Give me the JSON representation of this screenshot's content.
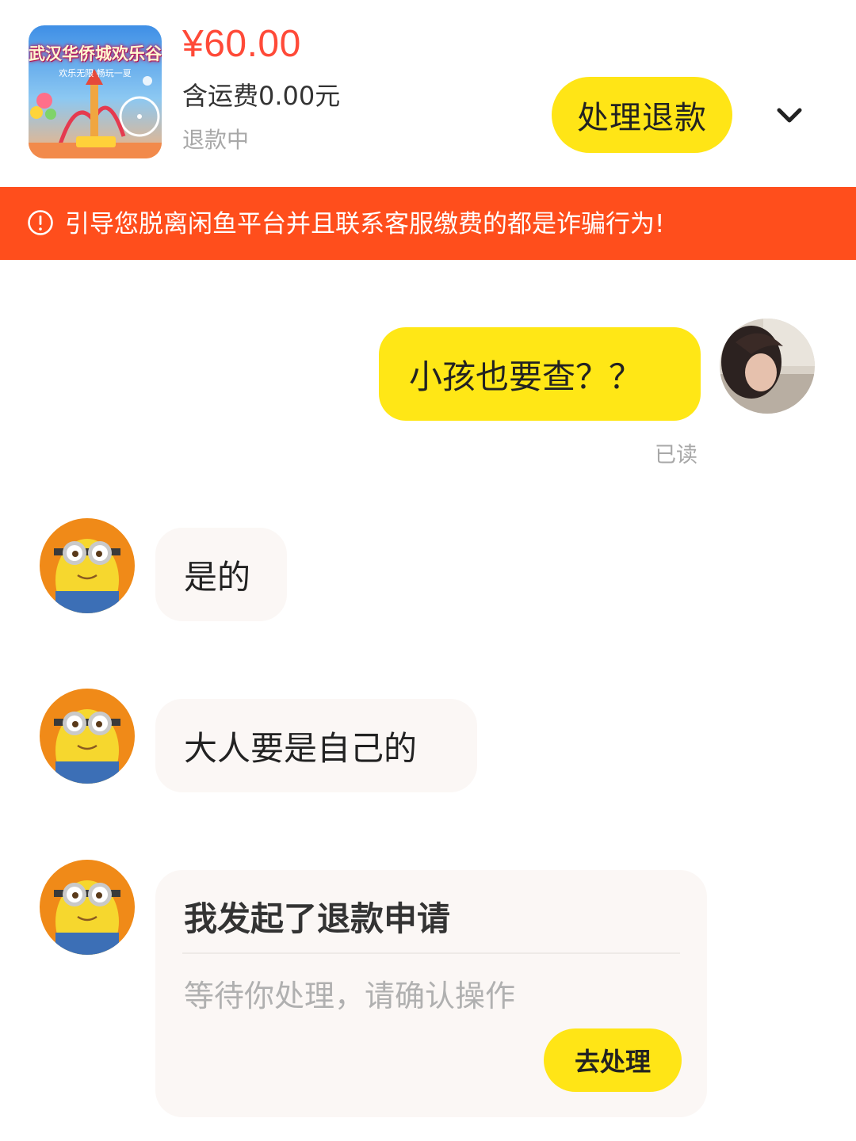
{
  "product": {
    "thumbnail_title": "武汉华侨城欢乐谷",
    "thumbnail_subtitle": "欢乐无限 畅玩一夏",
    "price": "¥60.00",
    "shipping": "含运费0.00元",
    "status": "退款中",
    "refund_button": "处理退款",
    "expand_icon": "chevron-down-icon"
  },
  "warning": {
    "icon": "alert-circle-icon",
    "text": "引导您脱离闲鱼平台并且联系客服缴费的都是诈骗行为!"
  },
  "messages": [
    {
      "side": "outgoing",
      "text": "小孩也要查？？",
      "read_receipt": "已读"
    },
    {
      "side": "incoming",
      "text": "是的"
    },
    {
      "side": "incoming",
      "text": "大人要是自己的"
    }
  ],
  "refund_card": {
    "title": "我发起了退款申请",
    "description": "等待你处理，请确认操作",
    "button": "去处理"
  },
  "colors": {
    "accent_yellow": "#ffe516",
    "warning_orange": "#ff4e1c",
    "price_red": "#ff4a38",
    "incoming_bubble": "#fbf7f5"
  }
}
